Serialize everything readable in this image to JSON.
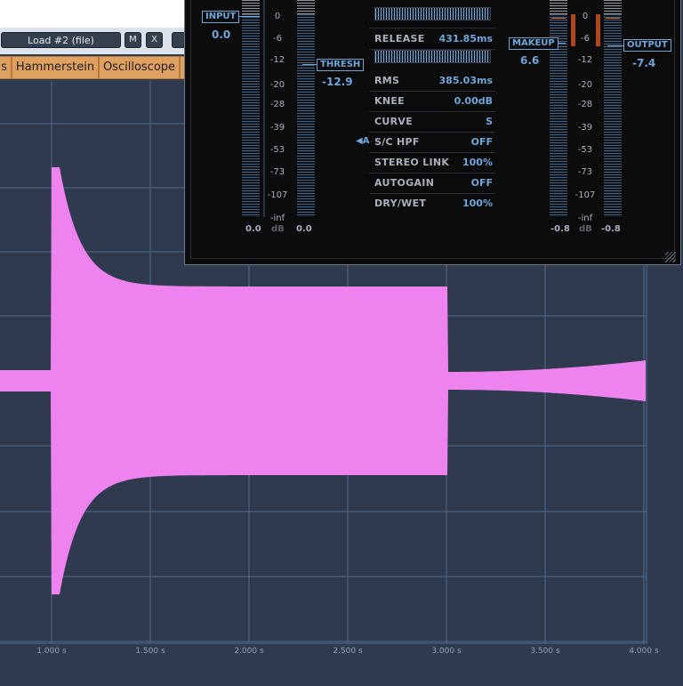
{
  "toolbar": {
    "load_label": "Load #2 (file)",
    "m_label": "M",
    "x_label": "X"
  },
  "tabs": [
    {
      "label": "s"
    },
    {
      "label": "Hammerstein"
    },
    {
      "label": "Oscilloscope"
    }
  ],
  "plugin": {
    "input_label": "INPUT",
    "input_value": "0.0",
    "thresh_label": "THRESH",
    "thresh_value": "-12.9",
    "makeup_label": "MAKEUP",
    "makeup_value": "6.6",
    "output_label": "OUTPUT",
    "output_value": "-7.4",
    "sc_marker": "◀A",
    "db_scale": [
      "0",
      "-6",
      "-12",
      "-20",
      "-28",
      "-39",
      "-53",
      "-73",
      "-107",
      "-inf"
    ],
    "left_footer": {
      "a": "0.0",
      "unit": "dB",
      "b": "0.0"
    },
    "right_footer": {
      "a": "-0.8",
      "unit": "dB",
      "b": "-0.8"
    },
    "params": [
      {
        "label": "RELEASE",
        "value": "431.85",
        "unit": "ms"
      },
      {
        "label": "RMS",
        "value": "385.03",
        "unit": "ms"
      },
      {
        "label": "KNEE",
        "value": "0.00",
        "unit": "dB"
      },
      {
        "label": "CURVE",
        "value": "S",
        "unit": ""
      },
      {
        "label": "S/C HPF",
        "value": "OFF",
        "unit": ""
      },
      {
        "label": "STEREO LINK",
        "value": "100",
        "unit": "%"
      },
      {
        "label": "AUTOGAIN",
        "value": "OFF",
        "unit": ""
      },
      {
        "label": "DRY/WET",
        "value": "100",
        "unit": "%"
      }
    ]
  },
  "scope": {
    "x_ticks": [
      "1.000 s",
      "1.500 s",
      "2.000 s",
      "2.500 s",
      "3.000 s",
      "3.500 s",
      "4.000 s"
    ],
    "waveform_color": "#ee82ee",
    "grid_color": "#4f6a8c",
    "background": "#2f3a4f"
  }
}
